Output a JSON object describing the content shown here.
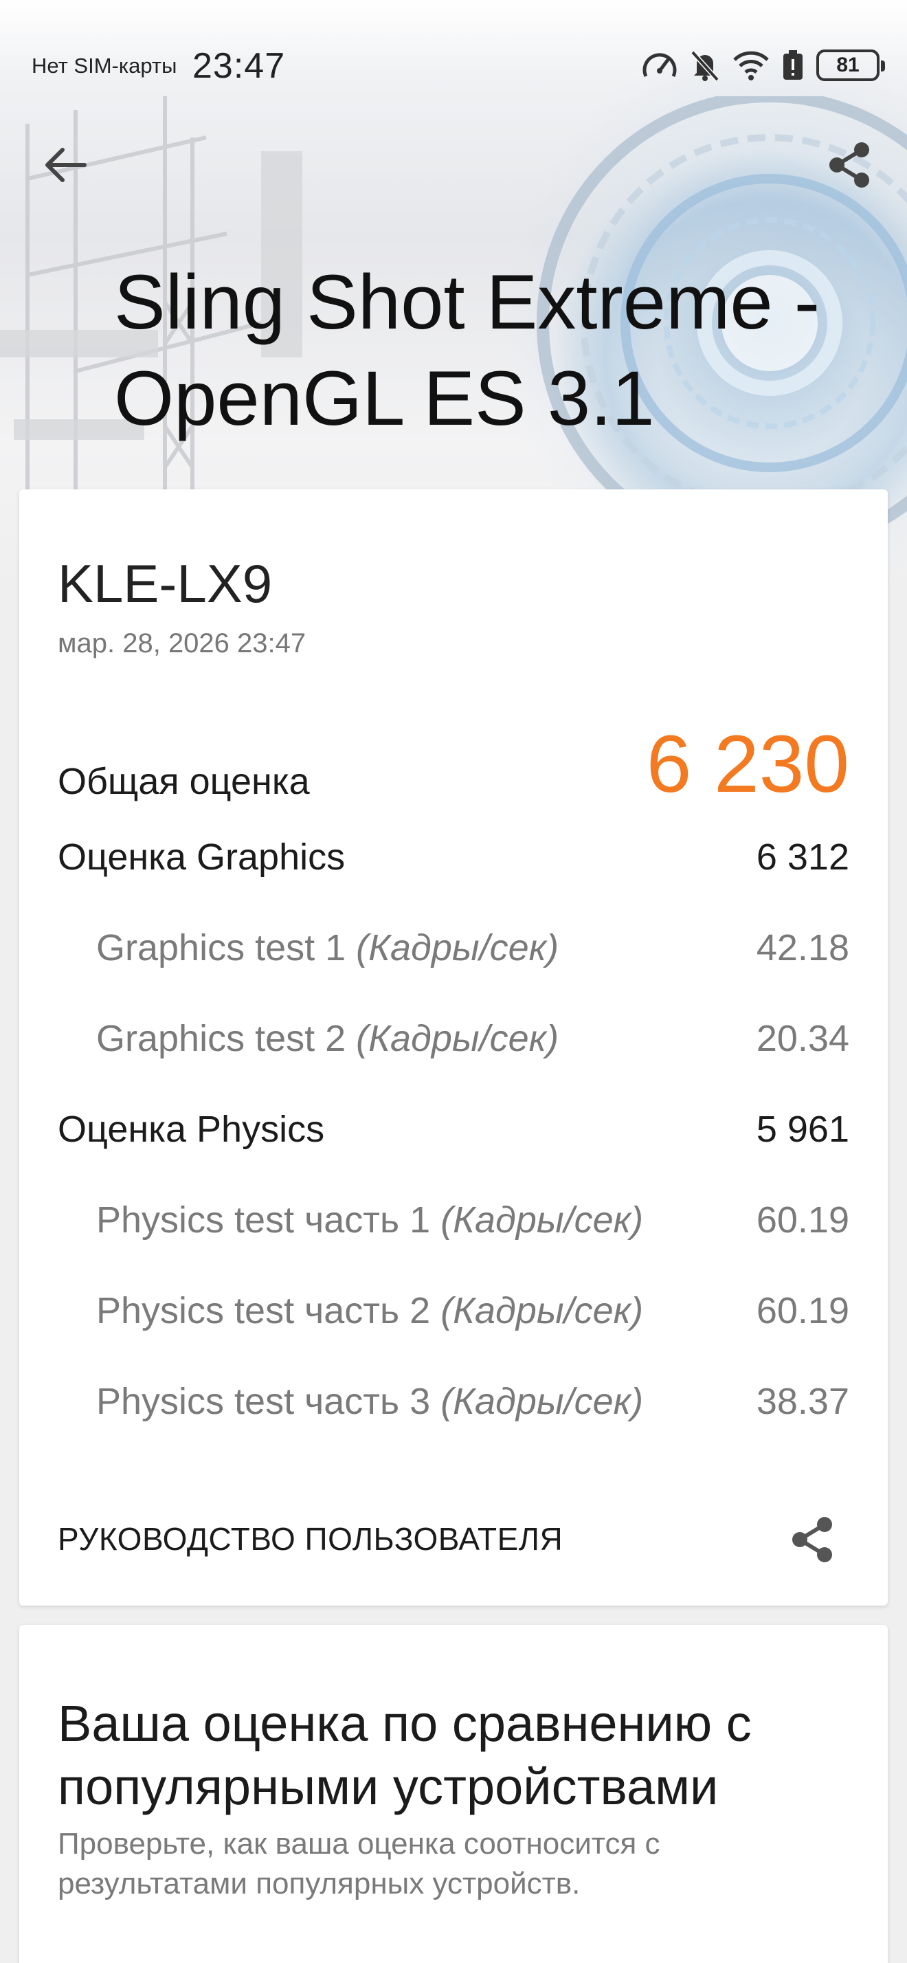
{
  "status_bar": {
    "carrier": "Нет SIM-карты",
    "time": "23:47",
    "battery": "81",
    "icons": [
      "speedometer-icon",
      "bell-off-icon",
      "wifi-icon",
      "battery-alert-icon",
      "battery-icon"
    ]
  },
  "header": {
    "title": "Sling Shot Extreme - OpenGL ES 3.1",
    "back_icon": "arrow-left-icon",
    "share_icon": "share-icon"
  },
  "result": {
    "device": "KLE-LX9",
    "date": "мар. 28, 2026 23:47",
    "overall_label": "Общая оценка",
    "overall_value": "6 230",
    "accent_color": "#f37a21",
    "rows": [
      {
        "label": "Оценка Graphics",
        "unit": "",
        "value": "6 312"
      },
      {
        "label": "Graphics test 1",
        "unit": "(Кадры/сек)",
        "value": "42.18"
      },
      {
        "label": "Graphics test 2",
        "unit": "(Кадры/сек)",
        "value": "20.34"
      },
      {
        "label": "Оценка Physics",
        "unit": "",
        "value": "5 961"
      },
      {
        "label": "Physics test часть 1",
        "unit": "(Кадры/сек)",
        "value": "60.19"
      },
      {
        "label": "Physics test часть 2",
        "unit": "(Кадры/сек)",
        "value": "60.19"
      },
      {
        "label": "Physics test часть 3",
        "unit": "(Кадры/сек)",
        "value": "38.37"
      }
    ],
    "guide_label": "РУКОВОДСТВО ПОЛЬЗОВАТЕЛЯ"
  },
  "compare": {
    "title": "Ваша оценка по сравнению с популярными устройствами",
    "description": "Проверьте, как ваша оценка соотносится с результатами популярных устройств."
  }
}
